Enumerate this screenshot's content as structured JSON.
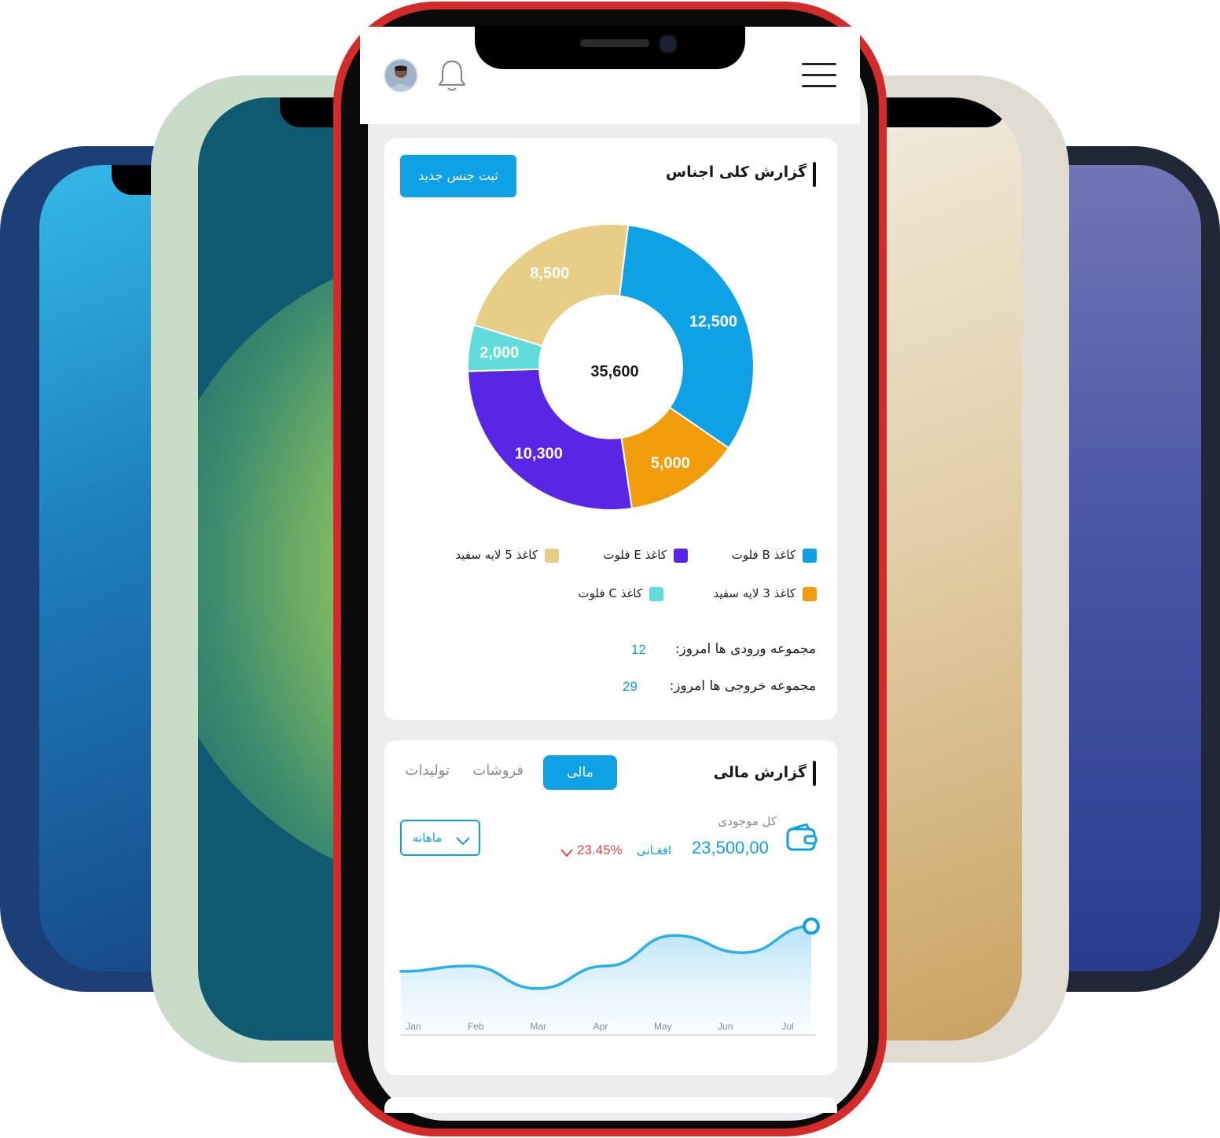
{
  "header": {
    "menu_icon": "hamburger-menu-icon",
    "bell_icon": "bell-icon",
    "avatar_icon": "user-avatar"
  },
  "category_report": {
    "title": "گزارش کلی اجناس",
    "add_button_label": "ثبت جنس جدید",
    "total": "35,600",
    "legend": [
      {
        "label": "کاغذ B فلوت",
        "color": "#0ea1e6"
      },
      {
        "label": "کاغذ E فلوت",
        "color": "#5a26e6"
      },
      {
        "label": "کاغذ 5 لایه سفید",
        "color": "#e8cd85"
      },
      {
        "label": "کاغذ 3 لایه سفید",
        "color": "#f19c0a"
      },
      {
        "label": "کاغذ C فلوت",
        "color": "#61dcdc"
      }
    ],
    "incoming_label": "مجموعه ورودی ها امروز:",
    "incoming_value": "12",
    "outgoing_label": "مجموعه خروجی ها امروز:",
    "outgoing_value": "29"
  },
  "chart_data": [
    {
      "type": "pie",
      "donut": true,
      "center_label": "35,600",
      "slices": [
        {
          "label": "12,500",
          "value": 12500,
          "color": "#0ea1e6"
        },
        {
          "label": "5,000",
          "value": 5000,
          "color": "#f19c0a"
        },
        {
          "label": "10,300",
          "value": 10300,
          "color": "#5a26e6"
        },
        {
          "label": "2,000",
          "value": 2000,
          "color": "#61dcdc"
        },
        {
          "label": "8,500",
          "value": 8500,
          "color": "#e8cd85"
        }
      ]
    },
    {
      "type": "area",
      "categories": [
        "Jan",
        "Feb",
        "Mar",
        "Apr",
        "May",
        "Jun",
        "Jul"
      ],
      "values": [
        48,
        52,
        35,
        52,
        75,
        62,
        82
      ],
      "line_color": "#2ab0ea",
      "grid": false
    }
  ],
  "finance": {
    "title": "گزارش مالی",
    "tabs": [
      {
        "label": "مالی",
        "active": true
      },
      {
        "label": "فروشات",
        "active": false
      },
      {
        "label": "تولیدات",
        "active": false
      }
    ],
    "balance_label": "کل موجودی",
    "balance_value": "23,500,00",
    "currency": "افغـانی",
    "change": "23.45%",
    "period_select": "ماهانه",
    "wallet_icon": "wallet-icon",
    "accent": "#0ea1e6",
    "negative_color": "#e64545"
  }
}
